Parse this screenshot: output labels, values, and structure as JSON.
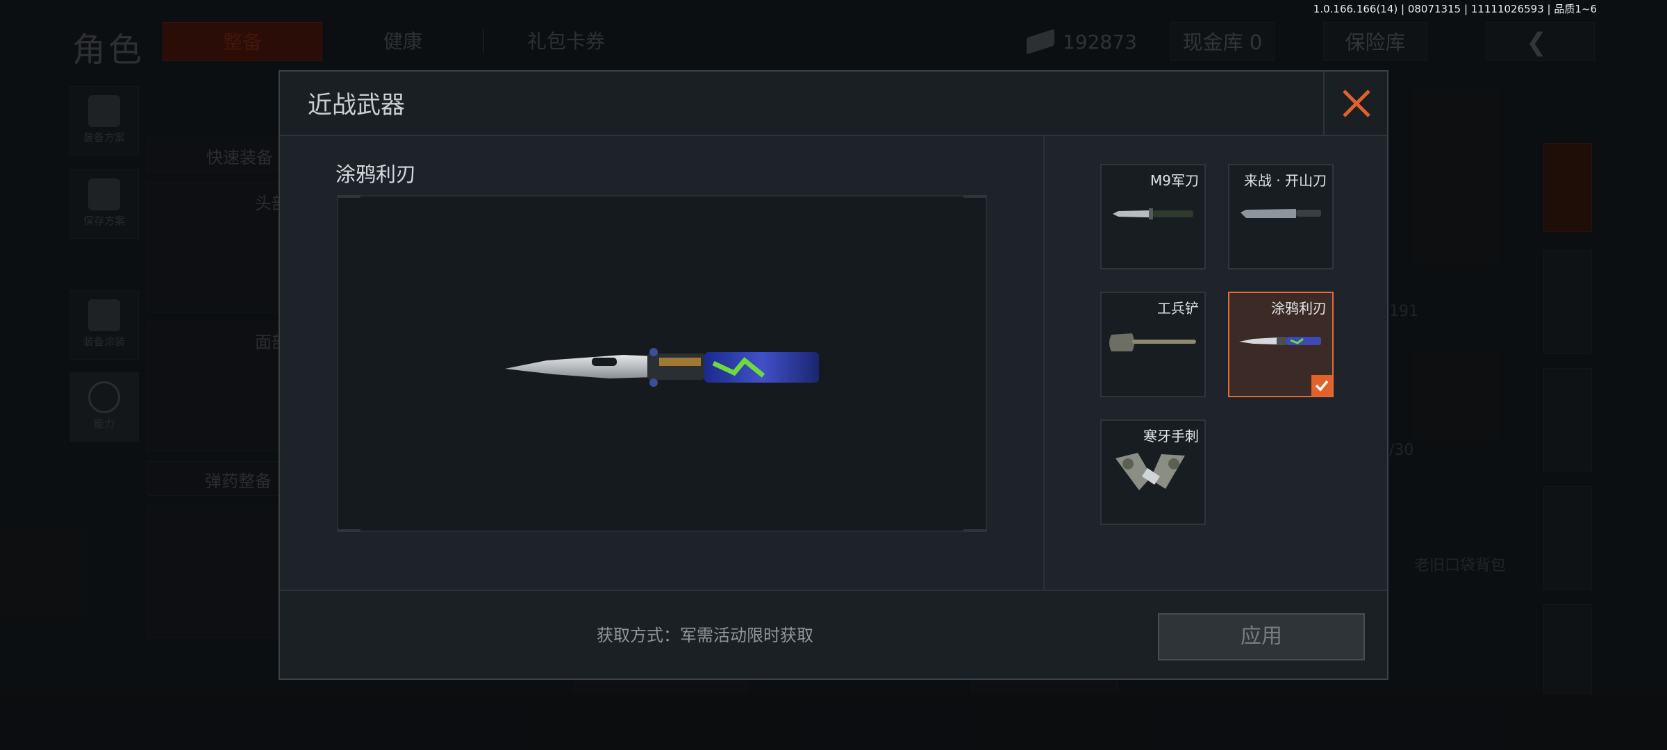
{
  "build_info": "1.0.166.166(14) | 08071315 | 11111026593 | 品质1~6",
  "background": {
    "page_title": "角色",
    "tabs": [
      "整备",
      "健康",
      "礼包卡券"
    ],
    "currency_amount": "192873",
    "cash_vault": "现金库 0",
    "insurance": "保险库",
    "sidebar": [
      "装备方案",
      "保存方案",
      "装备涂装",
      "能力"
    ],
    "quick_equip": "快速装备",
    "ammo_equip": "弹药整备",
    "head_label": "头部",
    "face_label": "面部",
    "old_bag": "老旧口袋背包",
    "partial_num_1": "191",
    "partial_num_2": "/30"
  },
  "modal": {
    "title": "近战武器",
    "selected_item_name": "涂鸦利刃",
    "items": [
      {
        "label": "M9军刀",
        "icon": "bayonet-icon"
      },
      {
        "label": "来战 · 开山刀",
        "icon": "machete-icon"
      },
      {
        "label": "工兵铲",
        "icon": "shovel-icon"
      },
      {
        "label": "涂鸦利刃",
        "icon": "butterfly-knife-icon",
        "selected": true
      },
      {
        "label": "寒牙手刺",
        "icon": "dual-daggers-icon"
      }
    ],
    "acquire_method": "获取方式：军需活动限时获取",
    "apply_label": "应用"
  },
  "colors": {
    "accent": "#e0632e",
    "selected_bg": "#3b2a25",
    "modal_bg": "#1c2227"
  }
}
